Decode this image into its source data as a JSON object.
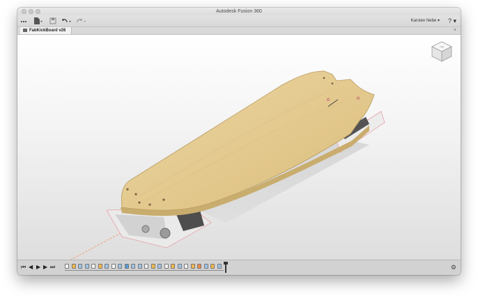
{
  "window": {
    "title": "Autodesk Fusion 360"
  },
  "toolbar": {
    "data_panel_icon": "grid-icon",
    "file_icon": "file-icon",
    "save_icon": "save-icon",
    "undo_icon": "undo-icon",
    "redo_icon": "redo-icon",
    "user_name": "Karsten Nebe ▾",
    "help_label": "? ▾"
  },
  "document": {
    "tab_label": "FabKickBoard v26",
    "close_label": "×"
  },
  "viewcube": {
    "label": "TOP"
  },
  "timeline": {
    "controls": [
      "⏮",
      "◀",
      "▶",
      "▶",
      "⏭"
    ],
    "features": [
      {
        "kind": "sketch",
        "color": "#f4f4f4"
      },
      {
        "kind": "extrude",
        "color": "#f2b84a"
      },
      {
        "kind": "body",
        "color": "#9fc4e8"
      },
      {
        "kind": "body",
        "color": "#9fc4e8"
      },
      {
        "kind": "sketch",
        "color": "#f4f4f4"
      },
      {
        "kind": "extrude",
        "color": "#f2b84a"
      },
      {
        "kind": "body",
        "color": "#9fc4e8"
      },
      {
        "kind": "sketch",
        "color": "#f4f4f4"
      },
      {
        "kind": "body",
        "color": "#9fc4e8"
      },
      {
        "kind": "move",
        "color": "#5a9bd5"
      },
      {
        "kind": "body",
        "color": "#9fc4e8"
      },
      {
        "kind": "body",
        "color": "#9fc4e8"
      },
      {
        "kind": "sketch",
        "color": "#f4f4f4"
      },
      {
        "kind": "extrude",
        "color": "#f2b84a"
      },
      {
        "kind": "body",
        "color": "#9fc4e8"
      },
      {
        "kind": "sketch",
        "color": "#f4f4f4"
      },
      {
        "kind": "extrude",
        "color": "#f2b84a"
      },
      {
        "kind": "body",
        "color": "#9fc4e8"
      },
      {
        "kind": "sketch",
        "color": "#f4f4f4"
      },
      {
        "kind": "extrude",
        "color": "#f2b84a"
      },
      {
        "kind": "fillet",
        "color": "#f08a4b"
      },
      {
        "kind": "body",
        "color": "#9fc4e8"
      },
      {
        "kind": "extrude",
        "color": "#f2b84a"
      },
      {
        "kind": "body",
        "color": "#9fc4e8"
      }
    ],
    "settings_icon": "gear-icon"
  },
  "colors": {
    "deck_top": "#e6cd94",
    "deck_edge": "#c9ad6e",
    "sketch_outline": "#e8a0a6",
    "axis_line": "#f0a070"
  }
}
